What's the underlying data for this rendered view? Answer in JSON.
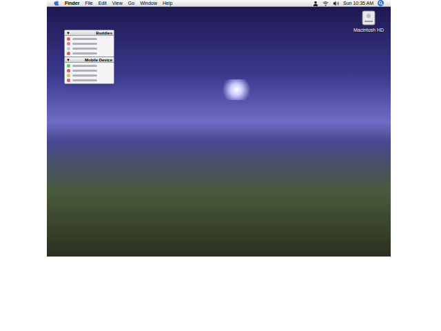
{
  "menu_bar": {
    "menus": [
      {
        "label": "Finder",
        "bold": true
      },
      {
        "label": "File",
        "bold": false
      },
      {
        "label": "Edit",
        "bold": false
      },
      {
        "label": "View",
        "bold": false
      },
      {
        "label": "Go",
        "bold": false
      },
      {
        "label": "Window",
        "bold": false
      },
      {
        "label": "Help",
        "bold": false
      }
    ],
    "clock": "Sun 10:35 AM"
  },
  "desktop": {
    "icons": [
      {
        "label": "Macintosh HD"
      }
    ]
  },
  "panels": [
    {
      "title": "Buddies",
      "toggle": "▼",
      "expanded": true,
      "items": [
        {
          "color": "#e05a5a"
        },
        {
          "color": "#e07a8a"
        },
        {
          "color": "#c8c8c8"
        },
        {
          "color": "#e05a5a"
        }
      ]
    },
    {
      "title": "Mobile Device",
      "toggle": "▼",
      "expanded": true,
      "items": [
        {
          "color": "#5ac85a"
        },
        {
          "color": "#e05a5a"
        },
        {
          "color": "#e0c040"
        },
        {
          "color": "#e05a5a"
        }
      ]
    }
  ]
}
